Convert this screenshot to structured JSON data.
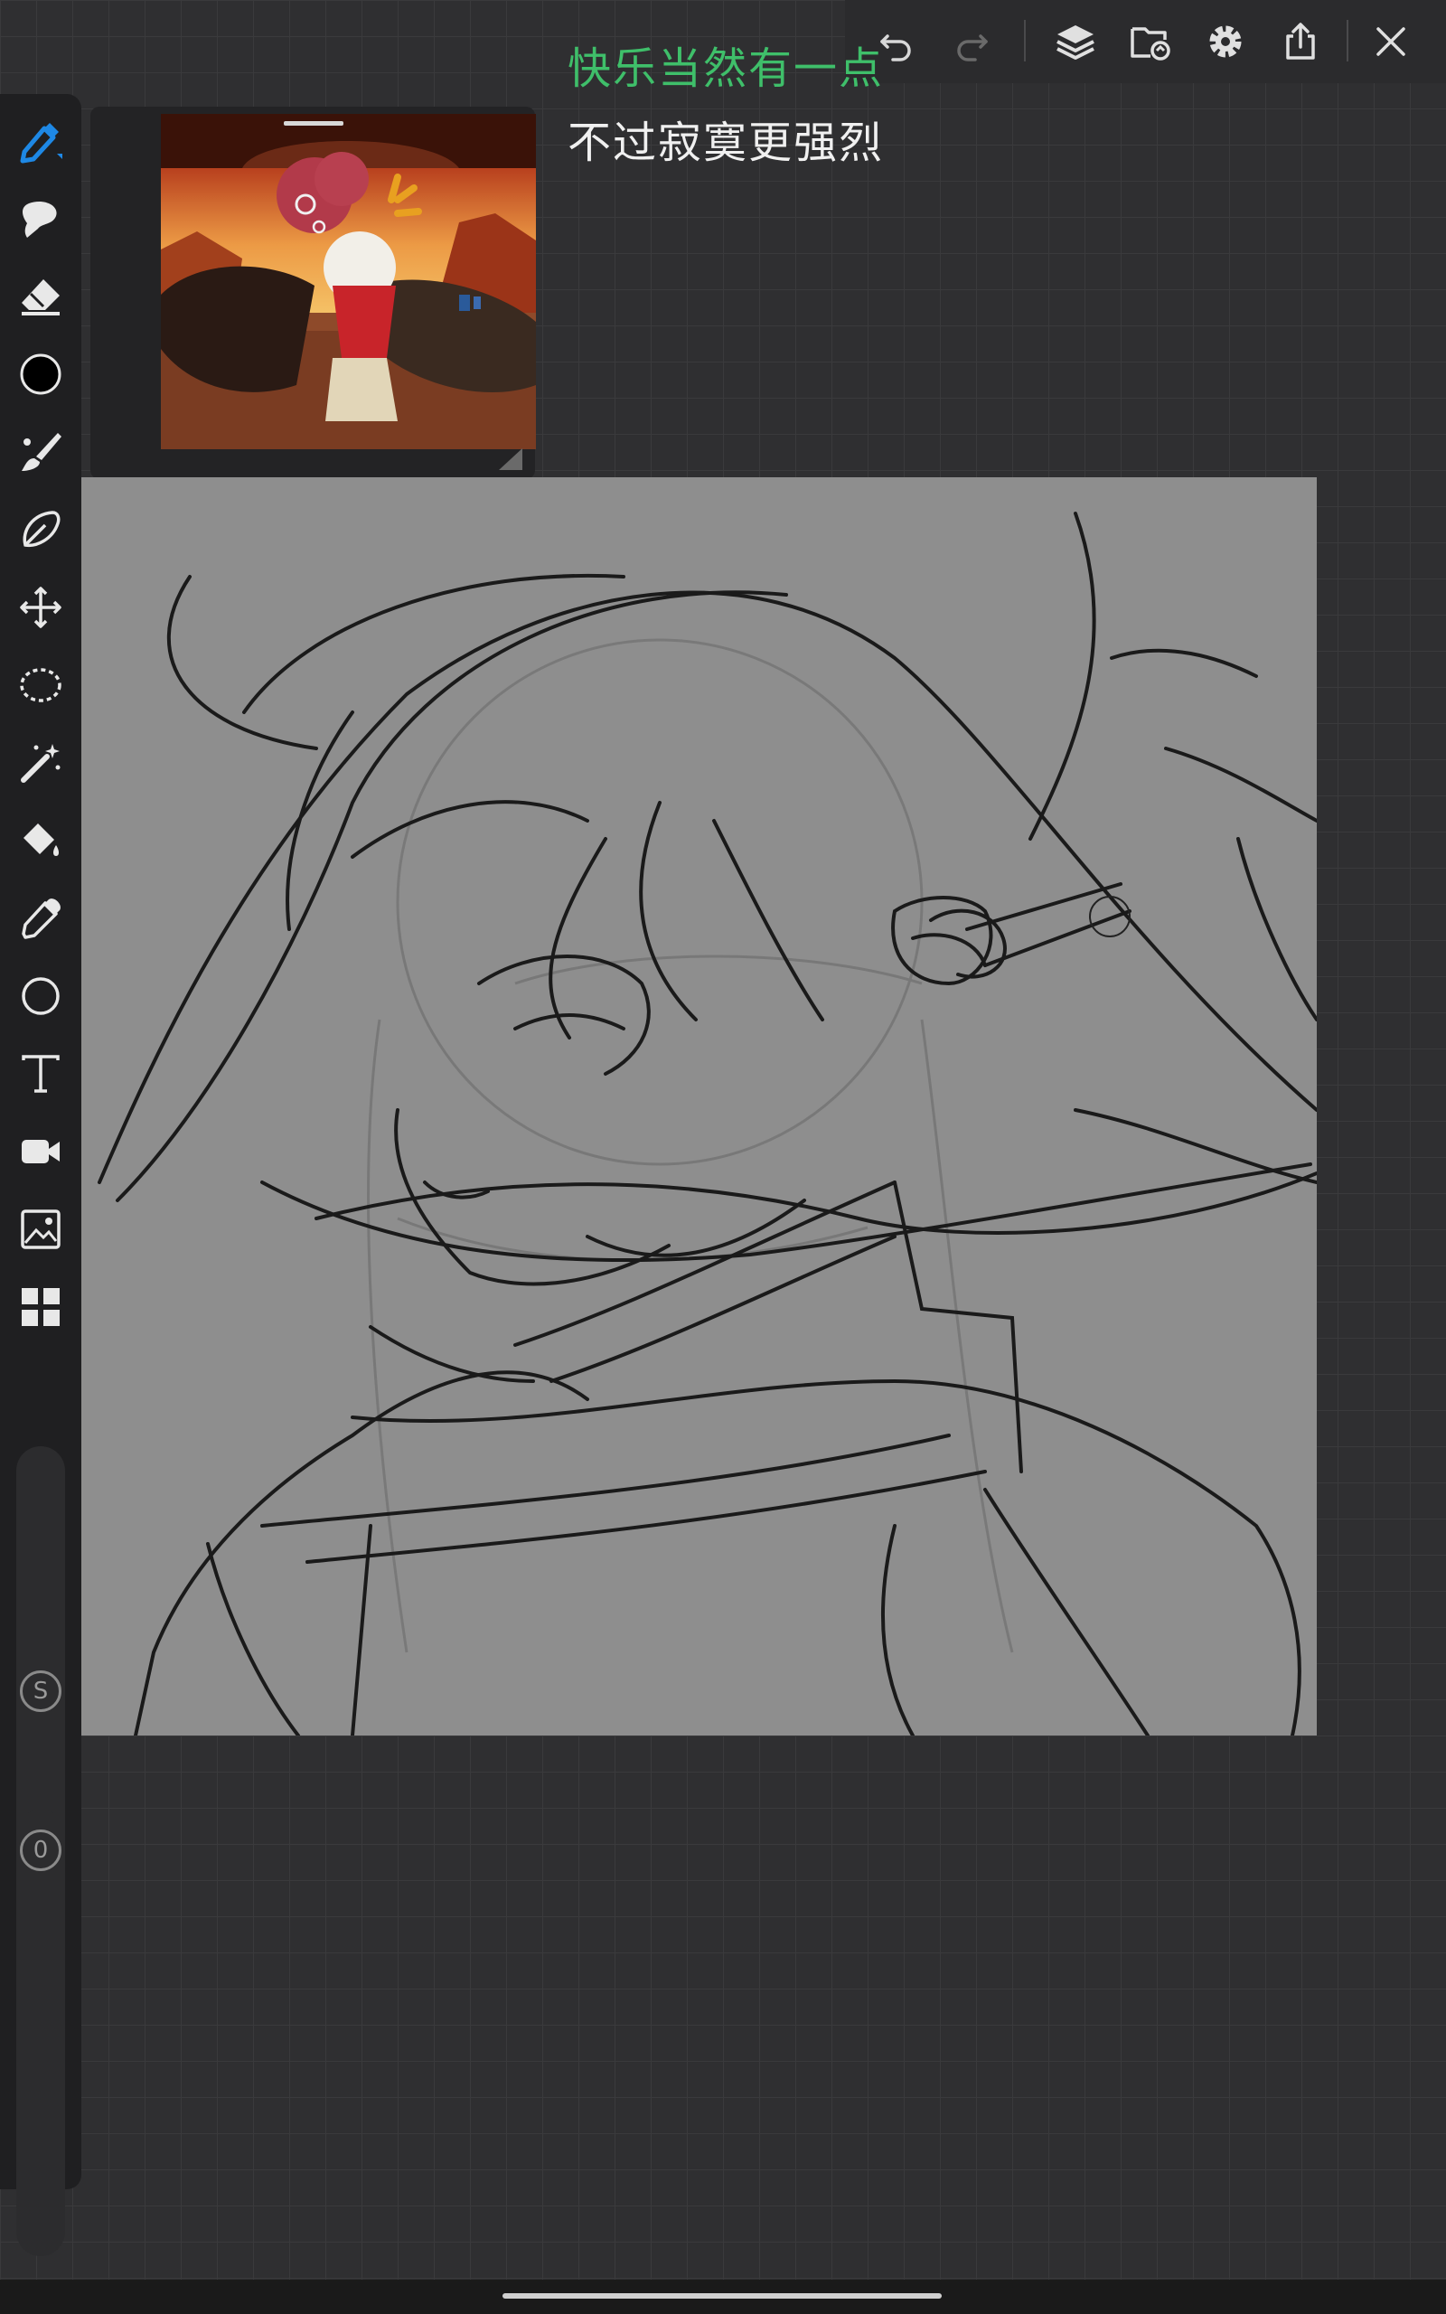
{
  "lyrics": {
    "line1": "快乐当然有一点",
    "line2": "不过寂寞更强烈"
  },
  "toolbar": {
    "icons": [
      "undo-icon",
      "redo-icon",
      "layers-icon",
      "import-icon",
      "gear-icon",
      "share-icon",
      "close-icon"
    ]
  },
  "sidebar": {
    "tools": [
      "pen-icon",
      "smudge-icon",
      "eraser-icon",
      "color-swatch",
      "brush-icon",
      "lasso-fill-icon",
      "move-icon",
      "selection-icon",
      "magic-wand-icon",
      "fill-bucket-icon",
      "eyedropper-icon",
      "shape-icon",
      "text-icon",
      "video-icon",
      "image-icon",
      "gallery-icon"
    ],
    "size_label": "S",
    "opacity_label": "0"
  },
  "colors": {
    "accent": "#1e88e5",
    "lyric_highlight": "#3fbf6a",
    "current_color": "#000000",
    "canvas": "#8e8e8e"
  }
}
